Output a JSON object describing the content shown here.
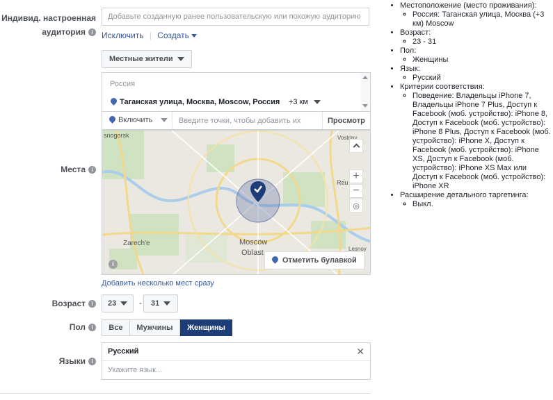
{
  "custom_audience": {
    "label": "Индивид. настроенная аудитория",
    "placeholder": "Добавьте созданную ранее пользовательскую или похожую аудиторию",
    "exclude_link": "Исключить",
    "create_link": "Создать"
  },
  "locations": {
    "label": "Места",
    "type_dropdown": "Местные жители",
    "country": "Россия",
    "location_item": "Таганская улица, Москва, Moscow, Россия",
    "radius": "+3 км",
    "include_dropdown": "Включить",
    "search_placeholder": "Введите точки, чтобы добавить их",
    "browse_button": "Просмотр",
    "drop_pin_button": "Отметить булавкой",
    "bulk_add_link": "Добавить несколько мест сразу",
    "map_labels": {
      "top_left": "snogorsk",
      "top_right": "Vostriny",
      "right_mid": "Reu",
      "left_bottom": "Zarech'e",
      "city": "Moscow",
      "region": "Oblast",
      "bottom_right": "Lesnoy"
    }
  },
  "age": {
    "label": "Возраст",
    "min": "23",
    "max": "31",
    "separator": "-"
  },
  "gender": {
    "label": "Пол",
    "options": [
      "Все",
      "Мужчины",
      "Женщины"
    ],
    "selected": "Женщины"
  },
  "languages": {
    "label": "Языки",
    "selected": "Русский",
    "placeholder": "Укажите язык..."
  },
  "summary": {
    "location_title": "Местоположение (место проживания):",
    "location_value": "Россия: Таганская улица, Москва (+3 км) Moscow",
    "age_title": "Возраст:",
    "age_value": "23 - 31",
    "gender_title": "Пол:",
    "gender_value": "Женщины",
    "language_title": "Язык:",
    "language_value": "Русский",
    "criteria_title": "Критерии соответствия:",
    "criteria_value": "Поведение: Владельцы iPhone 7, Владельцы iPhone 7 Plus, Доступ к Facebook (моб. устройство): iPhone 8, Доступ к Facebook (моб. устройство): iPhone 8 Plus, Доступ к Facebook (моб. устройство): iPhone X, Доступ к Facebook (моб. устройство): iPhone XS, Доступ к Facebook (моб. устройство): iPhone XS Max или Доступ к Facebook (моб. устройство): iPhone XR",
    "expansion_title": "Расширение детального таргетинга:",
    "expansion_value": "Выкл."
  },
  "colors": {
    "accent": "#365899",
    "selected_bg": "#1c3d77",
    "pin": "#4267b2"
  }
}
